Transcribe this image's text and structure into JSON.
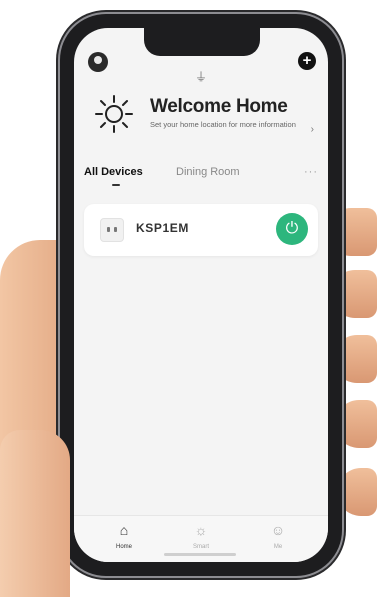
{
  "header": {
    "avatar_icon": "user-icon",
    "add_icon": "plus-circle-icon",
    "add_glyph": "+",
    "mic_icon": "mic-icon",
    "mic_glyph": "⏚"
  },
  "welcome": {
    "icon": "sun-icon",
    "title": "Welcome Home",
    "subtitle": "Set your home location for more information",
    "chevron": "›"
  },
  "tabs": {
    "items": [
      "All Devices",
      "Dining Room"
    ],
    "active": "All Devices",
    "more": "···"
  },
  "devices": [
    {
      "name": "KSP1EM",
      "icon": "outlet-icon",
      "power_on": true,
      "power_glyph": "⏻"
    }
  ],
  "bottom_nav": {
    "items": [
      {
        "label": "Home",
        "icon": "home-icon",
        "glyph": "⌂",
        "active": true
      },
      {
        "label": "Smart",
        "icon": "smart-icon",
        "glyph": "☼",
        "active": false
      },
      {
        "label": "Me",
        "icon": "profile-icon",
        "glyph": "☺",
        "active": false
      }
    ]
  },
  "colors": {
    "accent_green": "#2db67d",
    "screen_bg": "#f4f4f4",
    "card_bg": "#ffffff",
    "phone_frame": "#1d1d1f",
    "skin": "#e9b48f"
  }
}
